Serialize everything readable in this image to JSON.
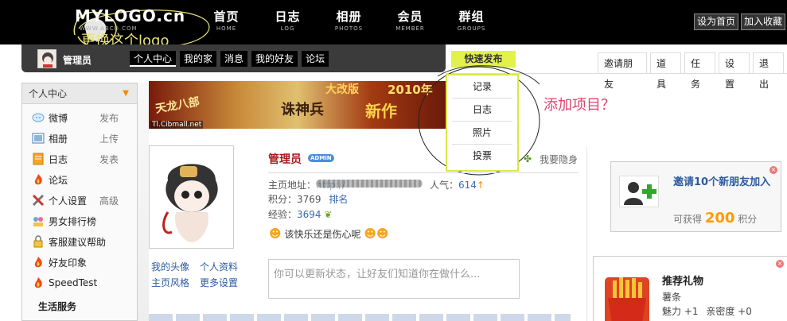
{
  "header": {
    "logo_text": "MYLOGO.cn",
    "logo_sub": "WWW.ABCD.COM",
    "logo_note": "更换这个logo",
    "nav": [
      {
        "cn": "首页",
        "en": "HOME"
      },
      {
        "cn": "日志",
        "en": "LOG"
      },
      {
        "cn": "相册",
        "en": "PHOTOS"
      },
      {
        "cn": "会员",
        "en": "MEMBER"
      },
      {
        "cn": "群组",
        "en": "GROUPS"
      }
    ],
    "set_home": "设为首页",
    "add_favorite": "加入收藏"
  },
  "userbar": {
    "username": "管理员",
    "tabs": [
      "个人中心",
      "我的家",
      "消息",
      "我的好友",
      "论坛"
    ]
  },
  "quick_publish": {
    "label": "快速发布",
    "items": [
      "记录",
      "日志",
      "照片",
      "投票"
    ],
    "note": "添加项目？"
  },
  "right_tabs": [
    "邀请朋友",
    "道具",
    "任务",
    "设置",
    "退出"
  ],
  "sidebar": {
    "title": "个人中心",
    "items": [
      {
        "label": "微博",
        "extra": "发布",
        "icon": "weibo-icon"
      },
      {
        "label": "相册",
        "extra": "上传",
        "icon": "photo-icon"
      },
      {
        "label": "日志",
        "extra": "发表",
        "icon": "log-icon"
      },
      {
        "label": "论坛",
        "extra": "",
        "icon": "fire-icon"
      },
      {
        "label": "个人设置",
        "extra": "高级",
        "icon": "tools-icon"
      },
      {
        "label": "男女排行榜",
        "extra": "",
        "icon": "ranking-icon"
      },
      {
        "label": "客服建议帮助",
        "extra": "",
        "icon": "lock-icon"
      },
      {
        "label": "好友印象",
        "extra": "",
        "icon": "fire-icon"
      },
      {
        "label": "SpeedTest",
        "extra": "",
        "icon": "fire-icon"
      }
    ],
    "section": "生活服务"
  },
  "banner": {
    "url_text": "Tl.Cibmall.net",
    "t1": "天龙八部",
    "t2": "大改版",
    "t3": "2010年",
    "t4": "新作",
    "t5": "诛神兵"
  },
  "profile": {
    "name": "管理员",
    "badge": "ADMIN",
    "hide_label": "我要隐身",
    "home_label": "主页地址：",
    "home_value": "http://",
    "popularity_label": "人气：",
    "popularity_value": "614",
    "points_label": "积分：",
    "points_value": "3769",
    "rank_label": "排名",
    "exp_label": "经验：",
    "exp_value": "3694",
    "mood": "该快乐还是伤心呢",
    "links": [
      "我的头像",
      "个人资料",
      "主页风格",
      "更多设置"
    ],
    "status_placeholder": "你可以更新状态，让好友们知道你在做什么..."
  },
  "invite": {
    "title": "邀请10个新朋友加入",
    "gain_prefix": "可获得",
    "gain_value": "200",
    "gain_suffix": "积分"
  },
  "gift": {
    "title": "推荐礼物",
    "name": "薯条",
    "charm": "魅力 +1",
    "intimacy": "亲密度 +0"
  }
}
